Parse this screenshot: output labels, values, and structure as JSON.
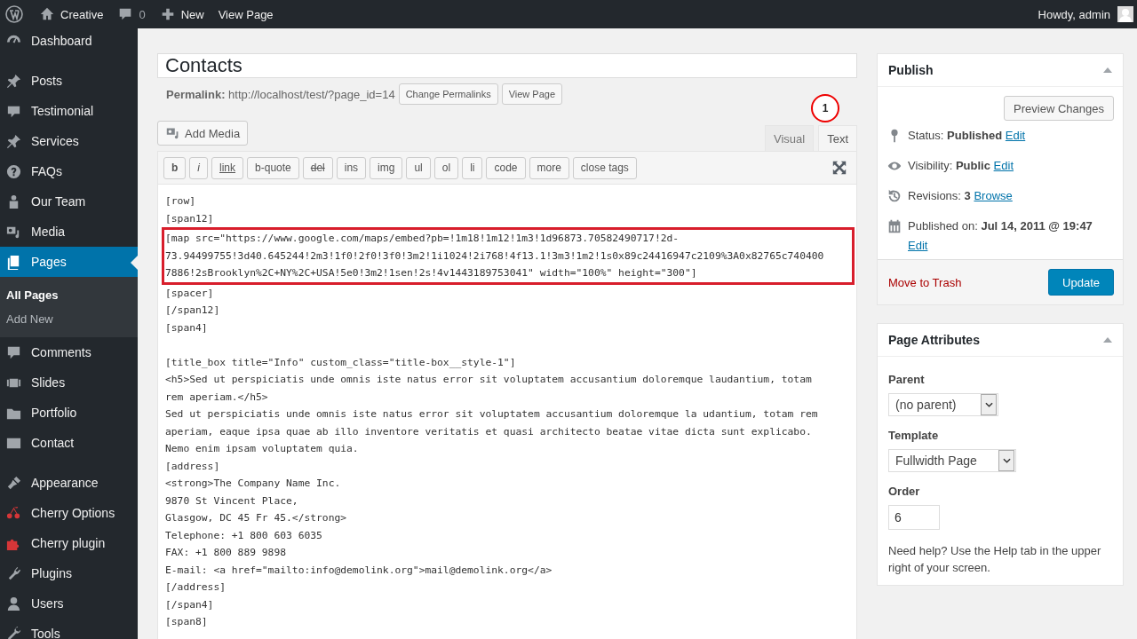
{
  "admin_bar": {
    "site": "Creative",
    "comments": "0",
    "new": "New",
    "view": "View Page",
    "greeting": "Howdy, admin"
  },
  "menu_groups": [
    [
      {
        "label": "Dashboard",
        "selected": false
      }
    ],
    [
      {
        "label": "Posts",
        "selected": false
      },
      {
        "label": "Testimonial",
        "selected": false
      },
      {
        "label": "Services",
        "selected": false
      },
      {
        "label": "FAQs",
        "selected": false
      },
      {
        "label": "Our Team",
        "selected": false
      },
      {
        "label": "Media",
        "selected": false
      },
      {
        "label": "Pages",
        "selected": true,
        "children": [
          {
            "label": "All Pages",
            "selected": true
          },
          {
            "label": "Add New",
            "selected": false
          }
        ]
      },
      {
        "label": "Comments",
        "selected": false
      },
      {
        "label": "Slides",
        "selected": false
      },
      {
        "label": "Portfolio",
        "selected": false
      },
      {
        "label": "Contact",
        "selected": false
      }
    ],
    [
      {
        "label": "Appearance",
        "selected": false
      },
      {
        "label": "Cherry Options",
        "selected": false
      },
      {
        "label": "Cherry plugin",
        "selected": false
      },
      {
        "label": "Plugins",
        "selected": false
      },
      {
        "label": "Users",
        "selected": false
      },
      {
        "label": "Tools",
        "selected": false
      }
    ]
  ],
  "title_field": {
    "value": "Contacts"
  },
  "permalink": {
    "text": "**Permalink:** http://localhost/test/?page_id=14",
    "buttons": [
      "Change Permalinks",
      "View Page"
    ]
  },
  "callout": {
    "number": "1"
  },
  "add_media": "Add Media",
  "tabs": [
    {
      "label": "Visual",
      "selected": false
    },
    {
      "label": "Text",
      "selected": true
    }
  ],
  "quicktags": [
    {
      "label": "b",
      "kind": "bold"
    },
    {
      "label": "i",
      "kind": "italic"
    },
    {
      "label": "link",
      "kind": "link"
    },
    {
      "label": "b-quote",
      "kind": "plain"
    },
    {
      "label": "del",
      "kind": "strike"
    },
    {
      "label": "ins",
      "kind": "plain"
    },
    {
      "label": "img",
      "kind": "plain"
    },
    {
      "label": "ul",
      "kind": "plain"
    },
    {
      "label": "ol",
      "kind": "plain"
    },
    {
      "label": "li",
      "kind": "plain"
    },
    {
      "label": "code",
      "kind": "plain"
    },
    {
      "label": "more",
      "kind": "plain"
    },
    {
      "label": "close tags",
      "kind": "plain"
    }
  ],
  "editor_blocks": [
    {
      "highlighted": false,
      "gap_before": false,
      "lines": [
        "[row]",
        "[span12]"
      ]
    },
    {
      "highlighted": true,
      "gap_before": false,
      "lines": [
        "[map src=\"https://www.google.com/maps/embed?pb=!1m18!1m12!1m3!1d96873.70582490717!2d-",
        "73.94499755!3d40.645244!2m3!1f0!2f0!3f0!3m2!1i1024!2i768!4f13.1!3m3!1m2!1s0x89c24416947c2109%3A0x82765c740400",
        "7886!2sBrooklyn%2C+NY%2C+USA!5e0!3m2!1sen!2s!4v1443189753041\" width=\"100%\" height=\"300\"]"
      ]
    },
    {
      "highlighted": false,
      "gap_before": false,
      "lines": [
        "[spacer]",
        "[/span12]",
        "[span4]"
      ]
    },
    {
      "highlighted": false,
      "gap_before": true,
      "lines": [
        "[title_box title=\"Info\" custom_class=\"title-box__style-1\"]",
        "<h5>Sed ut perspiciatis unde omnis iste natus error sit voluptatem accusantium doloremque laudantium, totam",
        "rem aperiam.</h5>",
        "Sed ut perspiciatis unde omnis iste natus error sit voluptatem accusantium doloremque la udantium, totam rem",
        "aperiam, eaque ipsa quae ab illo inventore veritatis et quasi architecto beatae vitae dicta sunt explicabo.",
        "Nemo enim ipsam voluptatem quia.",
        "[address]",
        "<strong>The Company Name Inc.",
        "9870 St Vincent Place,",
        "Glasgow, DC 45 Fr 45.</strong>",
        "Telephone: +1 800 603 6035",
        "FAX: +1 800 889 9898",
        "E-mail: <a href=\"mailto:info@demolink.org\">mail@demolink.org</a>",
        "[/address]",
        "[/span4]",
        "[span8]"
      ]
    }
  ],
  "publish": {
    "title": "Publish",
    "preview": "Preview Changes",
    "rows": [
      {
        "text": "Status: **Published**",
        "link": "Edit"
      },
      {
        "text": "Visibility: **Public**",
        "link": "Edit"
      },
      {
        "text": "Revisions: **3**",
        "link": "Browse"
      },
      {
        "text": "Published on: **Jul 14, 2011 @ 19:47**",
        "link": "Edit"
      }
    ],
    "trash": "Move to Trash",
    "update": "Update"
  },
  "page_attributes": {
    "title": "Page Attributes",
    "parent_label": "Parent",
    "parent": "(no parent)",
    "template_label": "Template",
    "template": "Fullwidth Page",
    "order_label": "Order",
    "order": "6",
    "help": "Need help? Use the Help tab in the upper right of your screen."
  }
}
